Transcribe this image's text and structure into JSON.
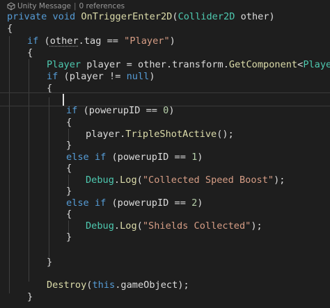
{
  "codelens": {
    "icon": "unity-icon",
    "message": "Unity Message",
    "separator": "|",
    "references": "0 references"
  },
  "colors": {
    "background": "#1e1e1e",
    "keyword": "#569cd6",
    "type": "#4ec9b0",
    "method": "#dcdcaa",
    "string": "#d69d85",
    "number": "#b5cea8",
    "plain": "#dcdcdc"
  },
  "code": {
    "l1": {
      "private": "private",
      "void": "void",
      "method": "OnTriggerEnter2D",
      "open": "(",
      "type": "Collider2D",
      "param": " other)"
    },
    "l2": {
      "text": "{"
    },
    "l3": {
      "if": "if",
      "open": " (",
      "other": "other",
      "rest": ".tag == ",
      "str": "\"Player\"",
      "close": ")"
    },
    "l4": {
      "text": "{"
    },
    "l5": {
      "type": "Player",
      "mid": " player = other.transform.",
      "method": "GetComponent",
      "lt": "<",
      "generic": "Player",
      "end": ">();"
    },
    "l6": {
      "if": "if",
      "mid": " (player != ",
      "null": "null",
      "close": ")"
    },
    "l7": {
      "text": "{"
    },
    "l9": {
      "if": "if",
      "mid": " (powerupID == ",
      "num": "0",
      "close": ")"
    },
    "l10": {
      "text": "{"
    },
    "l11": {
      "obj": "player.",
      "method": "TripleShotActive",
      "end": "();"
    },
    "l12": {
      "text": "}"
    },
    "l13": {
      "else": "else",
      "if": "if",
      "mid": " (powerupID == ",
      "num": "1",
      "close": ")"
    },
    "l14": {
      "text": "{"
    },
    "l15": {
      "type": "Debug",
      "dot": ".",
      "method": "Log",
      "open": "(",
      "str": "\"Collected Speed Boost\"",
      "end": ");"
    },
    "l16": {
      "text": "}"
    },
    "l17": {
      "else": "else",
      "if": "if",
      "mid": " (powerupID == ",
      "num": "2",
      "close": ")"
    },
    "l18": {
      "text": "{"
    },
    "l19": {
      "type": "Debug",
      "dot": ".",
      "method": "Log",
      "open": "(",
      "str": "\"Shields Collected\"",
      "end": ");"
    },
    "l20": {
      "text": "}"
    },
    "l22": {
      "text": "}"
    },
    "l24": {
      "method": "Destroy",
      "open": "(",
      "this": "this",
      "end": ".gameObject);"
    },
    "l25": {
      "text": "}"
    }
  }
}
